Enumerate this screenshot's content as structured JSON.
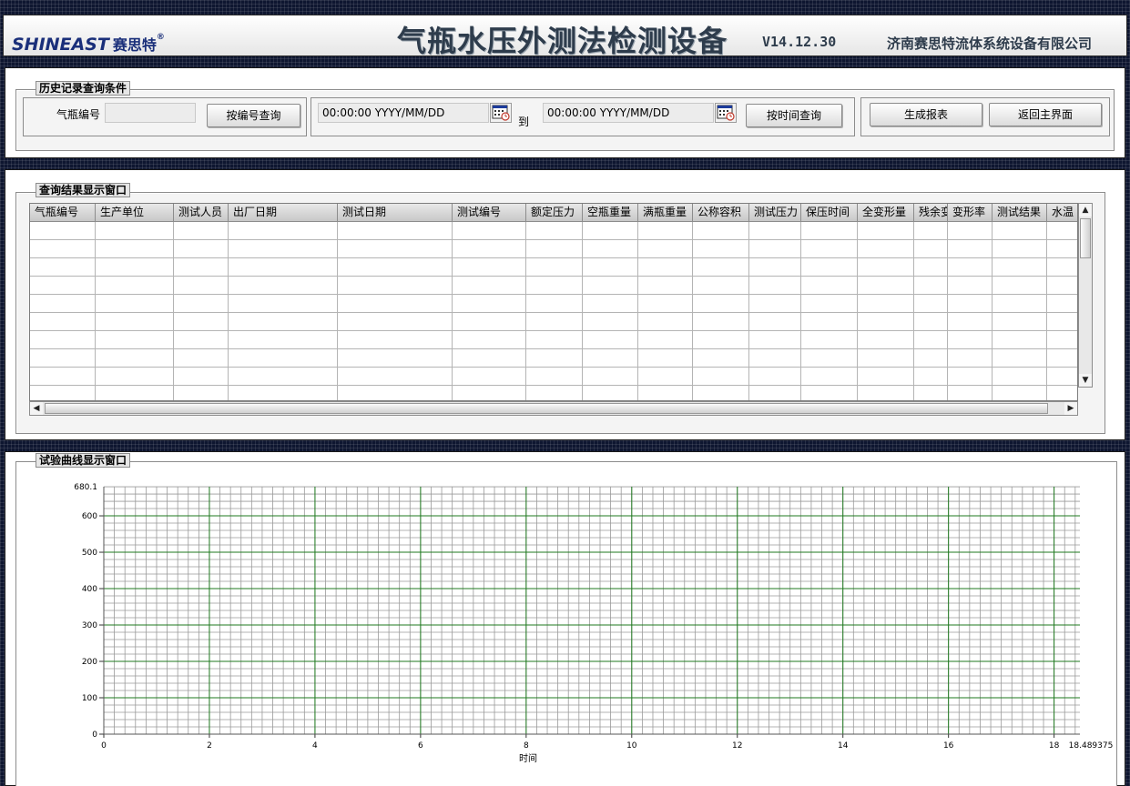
{
  "header": {
    "logo_text": "SHINEAST",
    "logo_cn": "赛思特",
    "logo_reg": "®",
    "title": "气瓶水压外测法检测设备",
    "version": "V14.12.30",
    "company": "济南赛思特流体系统设备有限公司"
  },
  "query": {
    "group_label": "历史记录查询条件",
    "cylinder_no_label": "气瓶编号",
    "cylinder_no_value": "",
    "by_number_button": "按编号查询",
    "start_time": "00:00:00 YYYY/MM/DD",
    "to_label": "到",
    "end_time": "00:00:00 YYYY/MM/DD",
    "by_time_button": "按时间查询",
    "report_button": "生成报表",
    "return_button": "返回主界面"
  },
  "results": {
    "group_label": "查询结果显示窗口",
    "columns": [
      "气瓶编号",
      "生产单位",
      "测试人员",
      "出厂日期",
      "测试日期",
      "测试编号",
      "额定压力",
      "空瓶重量",
      "满瓶重量",
      "公称容积",
      "测试压力",
      "保压时间",
      "全变形量",
      "残余变",
      "变形率",
      "测试结果",
      "水温"
    ],
    "row_count": 10
  },
  "curve": {
    "group_label": "试验曲线显示窗口"
  },
  "colors": {
    "grid_major": "#1f7a1f",
    "grid_minor": "#9a9a9a",
    "title": "#2e3c4c",
    "logo": "#1a2f7a"
  },
  "chart_data": {
    "type": "line",
    "title": "",
    "xlabel": "时间",
    "ylabel": "",
    "xlim": [
      0,
      18.489375
    ],
    "ylim": [
      0,
      680.1
    ],
    "x_ticks": [
      0,
      2,
      4,
      6,
      8,
      10,
      12,
      14,
      16,
      18
    ],
    "x_tick_labels": [
      "0",
      "2",
      "4",
      "6",
      "8",
      "10",
      "12",
      "14",
      "16",
      "18"
    ],
    "x_max_label": "18.489375",
    "y_ticks": [
      0,
      100,
      200,
      300,
      400,
      500,
      600
    ],
    "y_tick_labels": [
      "0",
      "100",
      "200",
      "300",
      "400",
      "500",
      "600"
    ],
    "y_max_label": "680.1",
    "x_minor_step": 0.2,
    "y_minor_step": 20,
    "grid": true,
    "series": []
  }
}
